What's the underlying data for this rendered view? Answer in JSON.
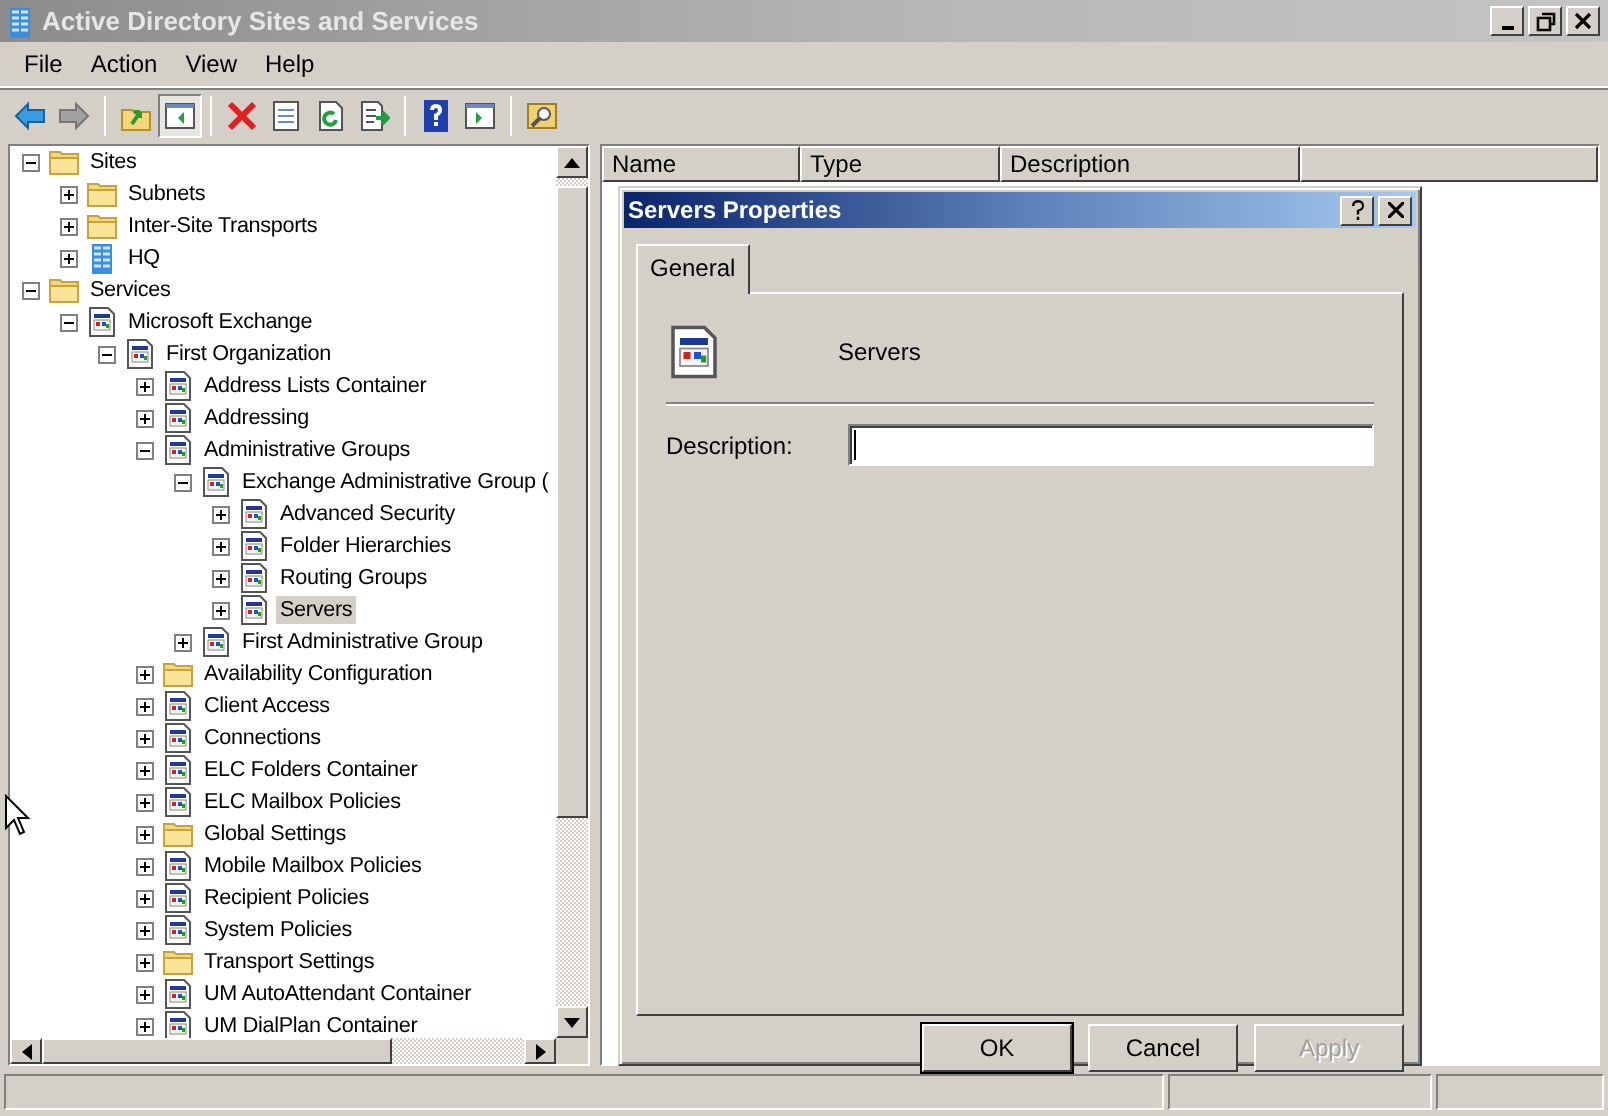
{
  "window": {
    "title": "Active Directory Sites and Services"
  },
  "menu": [
    "File",
    "Action",
    "View",
    "Help"
  ],
  "toolbar": [
    [
      {
        "kind": "back",
        "disabled": false,
        "pressed": false
      },
      {
        "kind": "forward",
        "disabled": true,
        "pressed": false
      }
    ],
    [
      {
        "kind": "up",
        "disabled": false,
        "pressed": false
      },
      {
        "kind": "tree",
        "disabled": false,
        "pressed": true
      }
    ],
    [
      {
        "kind": "delete",
        "disabled": false,
        "pressed": false
      },
      {
        "kind": "properties",
        "disabled": false,
        "pressed": false
      },
      {
        "kind": "refresh",
        "disabled": false,
        "pressed": false
      },
      {
        "kind": "export",
        "disabled": false,
        "pressed": false
      }
    ],
    [
      {
        "kind": "help",
        "disabled": false,
        "pressed": false
      },
      {
        "kind": "action-pane",
        "disabled": false,
        "pressed": false
      }
    ],
    [
      {
        "kind": "find",
        "disabled": false,
        "pressed": false
      }
    ]
  ],
  "tree": [
    {
      "label": "Sites",
      "kind": "folder",
      "expanded": true,
      "selected": false,
      "children": [
        {
          "label": "Subnets",
          "kind": "folder",
          "expanded": false,
          "selected": false
        },
        {
          "label": "Inter-Site Transports",
          "kind": "folder",
          "expanded": false,
          "selected": false
        },
        {
          "label": "HQ",
          "kind": "site",
          "expanded": false,
          "selected": false
        }
      ]
    },
    {
      "label": "Services",
      "kind": "folder",
      "expanded": true,
      "selected": false,
      "children": [
        {
          "label": "Microsoft Exchange",
          "kind": "object",
          "expanded": true,
          "selected": false,
          "children": [
            {
              "label": "First Organization",
              "kind": "object",
              "expanded": true,
              "selected": false,
              "children": [
                {
                  "label": "Address Lists Container",
                  "kind": "object",
                  "expanded": false,
                  "selected": false
                },
                {
                  "label": "Addressing",
                  "kind": "object",
                  "expanded": false,
                  "selected": false
                },
                {
                  "label": "Administrative Groups",
                  "kind": "object",
                  "expanded": true,
                  "selected": false,
                  "children": [
                    {
                      "label": "Exchange Administrative Group (",
                      "kind": "object",
                      "expanded": true,
                      "selected": false,
                      "children": [
                        {
                          "label": "Advanced Security",
                          "kind": "object",
                          "expanded": false,
                          "selected": false
                        },
                        {
                          "label": "Folder Hierarchies",
                          "kind": "object",
                          "expanded": false,
                          "selected": false
                        },
                        {
                          "label": "Routing Groups",
                          "kind": "object",
                          "expanded": false,
                          "selected": false
                        },
                        {
                          "label": "Servers",
                          "kind": "object",
                          "expanded": false,
                          "selected": true
                        }
                      ]
                    },
                    {
                      "label": "First Administrative Group",
                      "kind": "object",
                      "expanded": false,
                      "selected": false
                    }
                  ]
                },
                {
                  "label": "Availability Configuration",
                  "kind": "folder",
                  "expanded": false,
                  "selected": false
                },
                {
                  "label": "Client Access",
                  "kind": "object",
                  "expanded": false,
                  "selected": false
                },
                {
                  "label": "Connections",
                  "kind": "object",
                  "expanded": false,
                  "selected": false
                },
                {
                  "label": "ELC Folders Container",
                  "kind": "object",
                  "expanded": false,
                  "selected": false
                },
                {
                  "label": "ELC Mailbox Policies",
                  "kind": "object",
                  "expanded": false,
                  "selected": false
                },
                {
                  "label": "Global Settings",
                  "kind": "folder",
                  "expanded": false,
                  "selected": false
                },
                {
                  "label": "Mobile Mailbox Policies",
                  "kind": "object",
                  "expanded": false,
                  "selected": false
                },
                {
                  "label": "Recipient Policies",
                  "kind": "object",
                  "expanded": false,
                  "selected": false
                },
                {
                  "label": "System Policies",
                  "kind": "object",
                  "expanded": false,
                  "selected": false
                },
                {
                  "label": "Transport Settings",
                  "kind": "folder",
                  "expanded": false,
                  "selected": false
                },
                {
                  "label": "UM AutoAttendant Container",
                  "kind": "object",
                  "expanded": false,
                  "selected": false
                },
                {
                  "label": "UM DialPlan Container",
                  "kind": "object",
                  "expanded": false,
                  "selected": false
                }
              ]
            }
          ]
        }
      ]
    }
  ],
  "list": {
    "columns": [
      "Name",
      "Type",
      "Description"
    ]
  },
  "dialog": {
    "title": "Servers Properties",
    "tabs": [
      {
        "label": "General",
        "selected": true
      }
    ],
    "object_name": "Servers",
    "fields": [
      {
        "label": "Description:",
        "focused": true
      }
    ],
    "buttons": [
      {
        "label": "OK",
        "default": true,
        "disabled": false
      },
      {
        "label": "Cancel",
        "default": false,
        "disabled": false
      },
      {
        "label": "Apply",
        "default": false,
        "disabled": true
      }
    ]
  }
}
